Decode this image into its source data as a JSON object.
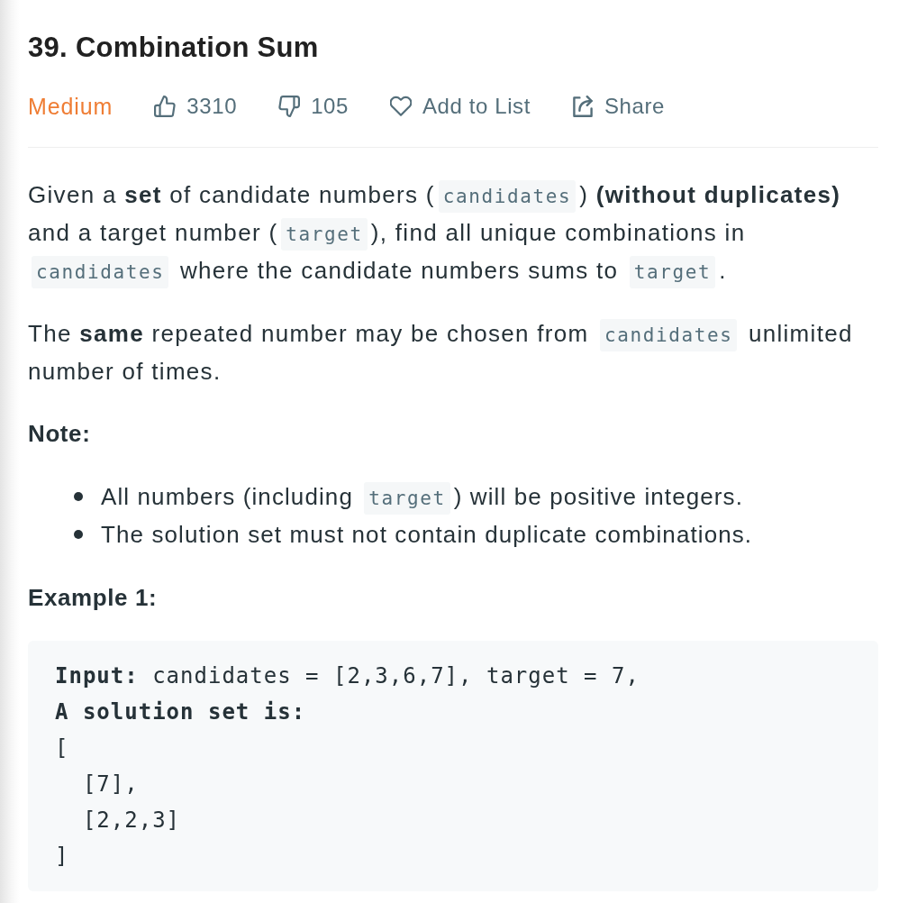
{
  "problem": {
    "title": "39. Combination Sum",
    "difficulty": "Medium"
  },
  "actions": [
    {
      "kind": "like",
      "label": "3310"
    },
    {
      "kind": "dislike",
      "label": "105"
    },
    {
      "kind": "add-to-list",
      "label": "Add to List"
    },
    {
      "kind": "share",
      "label": "Share"
    }
  ],
  "description": [
    [
      {
        "kind": "text",
        "text": "Given a **set** of candidate numbers ("
      },
      {
        "kind": "code",
        "text": "candidates"
      },
      {
        "kind": "text",
        "text": ") **(without duplicates)** and a target number ("
      },
      {
        "kind": "code",
        "text": "target"
      },
      {
        "kind": "text",
        "text": "), find all unique combinations in "
      },
      {
        "kind": "code",
        "text": "candidates"
      },
      {
        "kind": "text",
        "text": " where the candidate numbers sums to "
      },
      {
        "kind": "code",
        "text": "target"
      },
      {
        "kind": "text",
        "text": "."
      }
    ],
    [
      {
        "kind": "text",
        "text": "The **same** repeated number may be chosen from "
      },
      {
        "kind": "code",
        "text": "candidates"
      },
      {
        "kind": "text",
        "text": " unlimited number of times."
      }
    ]
  ],
  "note": {
    "heading": "Note:",
    "items": [
      [
        {
          "kind": "text",
          "text": "All numbers (including "
        },
        {
          "kind": "code",
          "text": "target"
        },
        {
          "kind": "text",
          "text": ") will be positive integers."
        }
      ],
      [
        {
          "kind": "text",
          "text": "The solution set must not contain duplicate combinations."
        }
      ]
    ]
  },
  "example": {
    "heading": "Example 1:",
    "code": "**Input:** candidates = [2,3,6,7], target = 7,\n**A solution set is:**\n[\n  [7],\n  [2,2,3]\n]"
  }
}
